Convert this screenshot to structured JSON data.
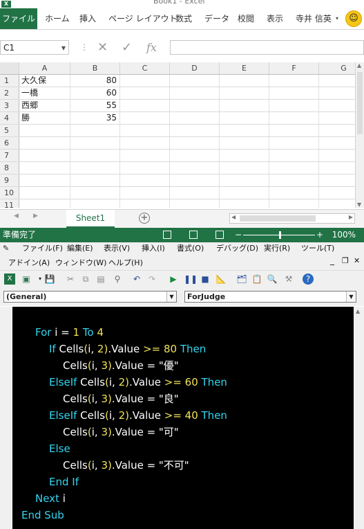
{
  "window": {
    "title": "Book1 - Excel"
  },
  "ribbon": {
    "tabs": [
      "ファイル",
      "ホーム",
      "挿入",
      "ページ レイアウト",
      "数式",
      "データ",
      "校閲",
      "表示"
    ],
    "user_name": "寺井 信英",
    "accent_color": "#217346"
  },
  "formula_bar": {
    "name_box": "C1",
    "fx_label": "fx",
    "value": ""
  },
  "sheet": {
    "columns": [
      "A",
      "B",
      "C",
      "D",
      "E",
      "F",
      "G"
    ],
    "row_numbers": [
      "1",
      "2",
      "3",
      "4",
      "5",
      "6",
      "7",
      "8",
      "9",
      "10",
      "11"
    ],
    "rows": [
      {
        "a": "大久保",
        "b": "80"
      },
      {
        "a": "一橋",
        "b": "60"
      },
      {
        "a": "西郷",
        "b": "55"
      },
      {
        "a": "勝",
        "b": "35"
      }
    ],
    "tab_name": "Sheet1",
    "add_sheet": "+"
  },
  "statusbar": {
    "status": "準備完了",
    "zoom": "100%",
    "zoom_fraction": 0.5
  },
  "vbe": {
    "menu_row1": [
      "ファイル(F)",
      "編集(E)",
      "表示(V)",
      "挿入(I)",
      "書式(O)",
      "デバッグ(D)",
      "実行(R)",
      "ツール(T)"
    ],
    "menu_row2": [
      "アドイン(A)",
      "ウィンドウ(W)",
      "ヘルプ(H)"
    ],
    "object_combo": "(General)",
    "procedure_combo": "ForJudge"
  },
  "code": {
    "lines": [
      {
        "indent": 0,
        "parts": [
          [
            "kw",
            "For"
          ],
          [
            "plain",
            " i = "
          ],
          [
            "num",
            "1"
          ],
          [
            "kw",
            " To "
          ],
          [
            "num",
            "4"
          ]
        ]
      },
      {
        "indent": 1,
        "parts": [
          [
            "kw",
            "If"
          ],
          [
            "plain",
            " Cells"
          ],
          [
            "paren",
            "("
          ],
          [
            "plain",
            "i, "
          ],
          [
            "num",
            "2"
          ],
          [
            "paren",
            ")"
          ],
          [
            "plain",
            ".Value "
          ],
          [
            "paren",
            ">="
          ],
          [
            "num",
            " 80"
          ],
          [
            "kw",
            " Then"
          ]
        ]
      },
      {
        "indent": 2,
        "parts": [
          [
            "plain",
            "Cells"
          ],
          [
            "paren",
            "("
          ],
          [
            "plain",
            "i, "
          ],
          [
            "num",
            "3"
          ],
          [
            "paren",
            ")"
          ],
          [
            "plain",
            ".Value = \"優\""
          ]
        ]
      },
      {
        "indent": 1,
        "parts": [
          [
            "kw",
            "ElseIf"
          ],
          [
            "plain",
            " Cells"
          ],
          [
            "paren",
            "("
          ],
          [
            "plain",
            "i, "
          ],
          [
            "num",
            "2"
          ],
          [
            "paren",
            ")"
          ],
          [
            "plain",
            ".Value "
          ],
          [
            "paren",
            ">="
          ],
          [
            "num",
            " 60"
          ],
          [
            "kw",
            " Then"
          ]
        ]
      },
      {
        "indent": 2,
        "parts": [
          [
            "plain",
            "Cells"
          ],
          [
            "paren",
            "("
          ],
          [
            "plain",
            "i, "
          ],
          [
            "num",
            "3"
          ],
          [
            "paren",
            ")"
          ],
          [
            "plain",
            ".Value = \"良\""
          ]
        ]
      },
      {
        "indent": 1,
        "parts": [
          [
            "kw",
            "ElseIf"
          ],
          [
            "plain",
            " Cells"
          ],
          [
            "paren",
            "("
          ],
          [
            "plain",
            "i, "
          ],
          [
            "num",
            "2"
          ],
          [
            "paren",
            ")"
          ],
          [
            "plain",
            ".Value "
          ],
          [
            "paren",
            ">="
          ],
          [
            "num",
            " 40"
          ],
          [
            "kw",
            " Then"
          ]
        ]
      },
      {
        "indent": 2,
        "parts": [
          [
            "plain",
            "Cells"
          ],
          [
            "paren",
            "("
          ],
          [
            "plain",
            "i, "
          ],
          [
            "num",
            "3"
          ],
          [
            "paren",
            ")"
          ],
          [
            "plain",
            ".Value = \"可\""
          ]
        ]
      },
      {
        "indent": 1,
        "parts": [
          [
            "kw",
            "Else"
          ]
        ]
      },
      {
        "indent": 2,
        "parts": [
          [
            "plain",
            "Cells"
          ],
          [
            "paren",
            "("
          ],
          [
            "plain",
            "i, "
          ],
          [
            "num",
            "3"
          ],
          [
            "paren",
            ")"
          ],
          [
            "plain",
            ".Value = \"不可\""
          ]
        ]
      },
      {
        "indent": 1,
        "parts": [
          [
            "kw",
            "End If"
          ]
        ]
      },
      {
        "indent": 0,
        "parts": [
          [
            "kw",
            "Next"
          ],
          [
            "plain",
            " i"
          ]
        ]
      },
      {
        "indent": -1,
        "parts": [
          [
            "kw",
            "End Sub"
          ]
        ]
      }
    ]
  }
}
